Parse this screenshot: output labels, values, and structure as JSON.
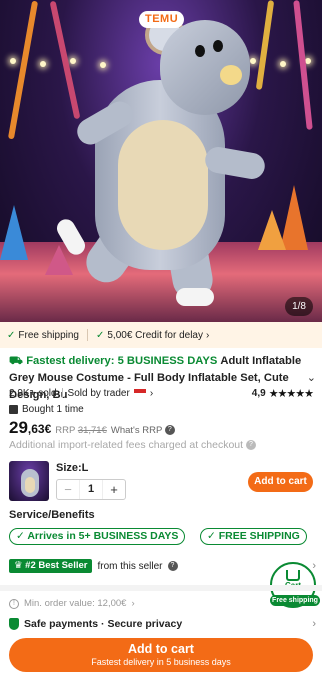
{
  "hero": {
    "badge": "TEMU",
    "page_counter": "1/8"
  },
  "shipping_bar": {
    "free_shipping": "Free shipping",
    "credit": "5,00€ Credit for delay"
  },
  "product": {
    "fast_delivery": "Fastest delivery: 5 BUSINESS DAYS",
    "title": "Adult Inflatable Grey Mouse Costume - Full Body Inflatable Set, Cute Design, Bu",
    "sold": "2,9K+ sold",
    "sold_by": "Sold by trader",
    "rating": "4,9",
    "stars": "★★★★★",
    "bought": "Bought 1 time",
    "price_int": "29",
    "price_dec": ",63€",
    "rrp_label": "RRP",
    "rrp_value": "31,71€",
    "whats_rrp": "What's RRP",
    "fees_note": "Additional import-related fees charged at checkout"
  },
  "options": {
    "size": "Size:L",
    "qty": "1",
    "minus": "−",
    "plus": "+",
    "add_to_cart": "Add to cart"
  },
  "services": {
    "title": "Service/Benefits",
    "badge1": "✓ Arrives in 5+ BUSINESS DAYS",
    "badge2": "✓ FREE SHIPPING"
  },
  "seller": {
    "badge": "#2 Best Seller",
    "text": "from this seller"
  },
  "cart_float": {
    "label": "Cart",
    "free": "Free shipping"
  },
  "min_order": "Min. order value: 12,00€",
  "safe": "Safe payments · Secure privacy",
  "bottom_cta": {
    "label": "Add to cart",
    "sub": "Fastest delivery in 5 business days"
  },
  "colors": {
    "brand_orange": "#f36b16",
    "success_green": "#0a8a33"
  }
}
